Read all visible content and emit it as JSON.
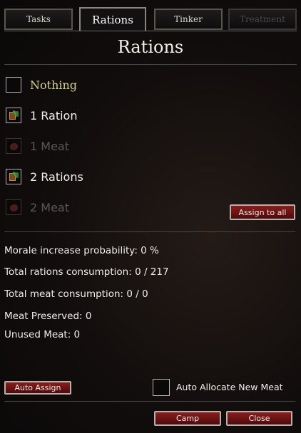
{
  "tabs": [
    {
      "label": "Tasks"
    },
    {
      "label": "Rations"
    },
    {
      "label": "Tinker"
    },
    {
      "label": "Treatment"
    }
  ],
  "title": "Rations",
  "options": [
    {
      "label": "Nothing",
      "icon": "empty"
    },
    {
      "label": "1 Ration",
      "icon": "ration-icon"
    },
    {
      "label": "1 Meat",
      "icon": "meat-icon"
    },
    {
      "label": "2 Rations",
      "icon": "ration-icon"
    },
    {
      "label": "2 Meat",
      "icon": "meat-icon"
    }
  ],
  "assign_all_label": "Assign to all",
  "stats": {
    "morale": "Morale increase probability: 0 %",
    "rations": "Total rations consumption: 0 / 217",
    "meat": "Total meat consumption: 0 / 0",
    "preserved": "Meat Preserved: 0",
    "unused": "Unused Meat: 0"
  },
  "footer": {
    "auto_assign_label": "Auto Assign",
    "auto_allocate_label": "Auto Allocate New Meat",
    "camp_label": "Camp",
    "close_label": "Close"
  },
  "colors": {
    "accent_red": "#7a1515",
    "gold_text": "#d6cf8c"
  }
}
